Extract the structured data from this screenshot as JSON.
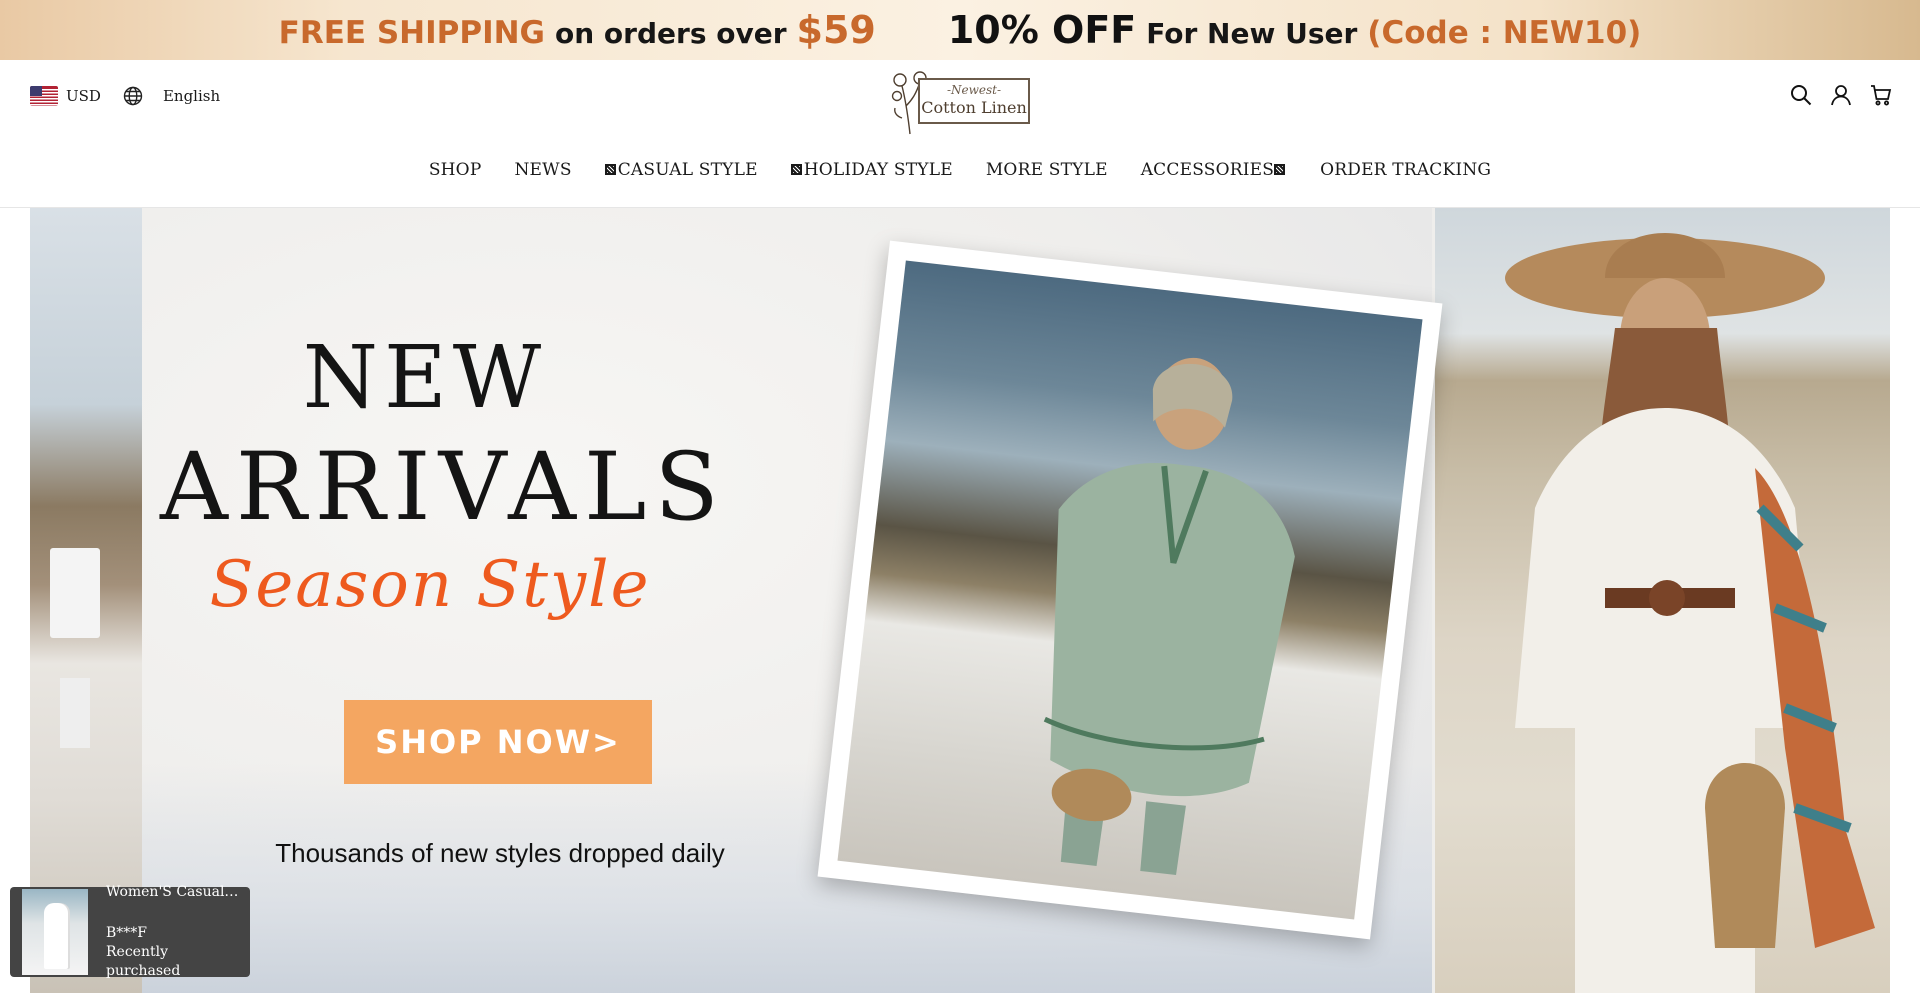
{
  "announcement": {
    "free_shipping": "FREE SHIPPING",
    "on_orders_over": "on orders over",
    "threshold": "$59",
    "discount": "10% OFF",
    "for_new_user": "For New User",
    "code": "(Code : NEW10)"
  },
  "header": {
    "currency": "USD",
    "language": "English",
    "logo": {
      "line1": "-Newest-",
      "line2": "Cotton Linen"
    }
  },
  "nav": {
    "items": [
      {
        "label": "SHOP"
      },
      {
        "label": "NEWS"
      },
      {
        "label": "CASUAL STYLE"
      },
      {
        "label": "HOLIDAY STYLE"
      },
      {
        "label": "MORE STYLE"
      },
      {
        "label": "ACCESSORIES"
      },
      {
        "label": "ORDER TRACKING"
      }
    ]
  },
  "hero": {
    "headline_line1": "NEW",
    "headline_line2": "ARRIVALS",
    "headline_line3": "Season Style",
    "cta": "SHOP NOW>",
    "tagline": "Thousands of new styles dropped daily"
  },
  "toast": {
    "product": "Women'S Casual F...",
    "buyer": "B***F",
    "status": "Recently purchased"
  },
  "icons": [
    "us-flag-icon",
    "globe-icon",
    "search-icon",
    "account-icon",
    "cart-icon"
  ],
  "colors": {
    "accent_orange": "#c8692c",
    "cta_orange": "#f4a661",
    "script_orange": "#ee5a1e"
  }
}
